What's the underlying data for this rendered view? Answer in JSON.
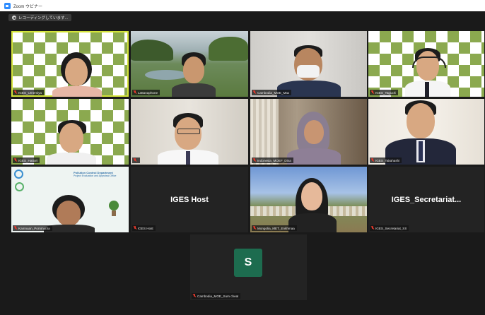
{
  "window": {
    "title": "Zoom ウビナー",
    "recording_label": "レコーディングしています..."
  },
  "colors": {
    "stage_bg": "#1a1a1a",
    "active_speaker_outline": "#d4e33a",
    "mic_muted": "#e0382c",
    "avatar_bg": "#1d6c4f"
  },
  "participants": [
    {
      "name": "IGES_Umemiya",
      "muted": true
    },
    {
      "name": "Lattanaphone",
      "muted": true
    },
    {
      "name": "Cambodia_MOE_Mao",
      "muted": true
    },
    {
      "name": "IGES_Taguchi",
      "muted": true
    },
    {
      "name": "IGES_Hattori",
      "muted": true
    },
    {
      "name": "",
      "muted": true
    },
    {
      "name": "Indonesia_MOEF_Dina",
      "muted": true
    },
    {
      "name": "IGES_Takahashi",
      "muted": true
    },
    {
      "name": "Kamnuan_Pornmatha",
      "muted": true
    },
    {
      "name": "IGES Host",
      "muted": true,
      "big_label": "IGES Host"
    },
    {
      "name": "Mongolia_MET_Enkhmaa",
      "muted": true
    },
    {
      "name": "IGES_Secretariat_SS",
      "muted": true,
      "big_label": "IGES_Secretariat..."
    },
    {
      "name": "Cambodia_MOE_Sum cheat",
      "muted": true,
      "avatar_letter": "S"
    }
  ],
  "banner": {
    "line1": "Pollution Control Department",
    "line2": "Project Evaluation and Appraisal Office"
  }
}
